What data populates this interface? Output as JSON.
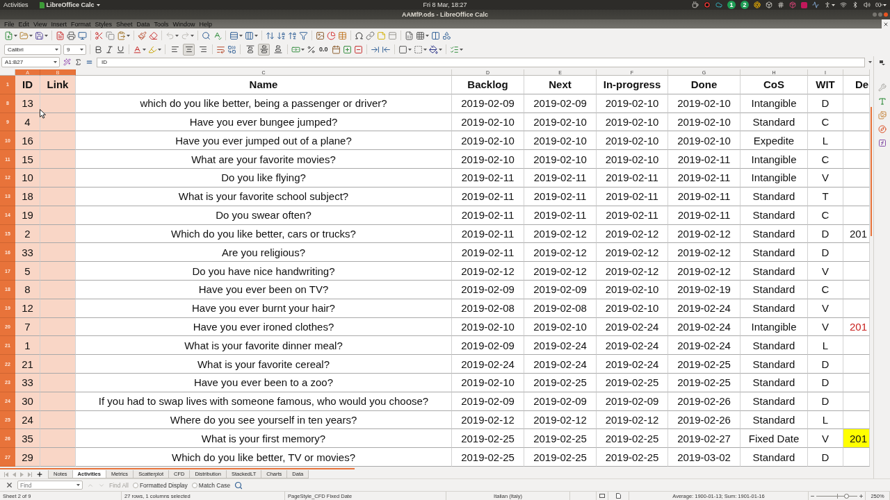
{
  "top_bar": {
    "activities": "Activities",
    "app_menu": "LibreOffice Calc",
    "clock": "Fri 8 Mar, 18:27",
    "tray_badges": [
      "1",
      "2"
    ]
  },
  "window": {
    "title": "AAMfP.ods - LibreOffice Calc"
  },
  "menu": [
    "File",
    "Edit",
    "View",
    "Insert",
    "Format",
    "Styles",
    "Sheet",
    "Data",
    "Tools",
    "Window",
    "Help"
  ],
  "toolbar": {
    "font_name": "Calibri",
    "font_size": "9",
    "number_format": "0.0",
    "horizontal_align": [
      {
        "kind": "left",
        "selected": false
      },
      {
        "kind": "center",
        "selected": true
      },
      {
        "kind": "right",
        "selected": false
      }
    ],
    "vertical_align": [
      {
        "kind": "top",
        "selected": false
      },
      {
        "kind": "middle",
        "selected": true
      },
      {
        "kind": "bottom",
        "selected": false
      }
    ]
  },
  "formula_bar": {
    "name_box": "A1:B27",
    "content": "ID"
  },
  "column_letters": [
    {
      "label": "A",
      "selected": true
    },
    {
      "label": "B",
      "selected": true
    },
    {
      "label": "C",
      "selected": false
    },
    {
      "label": "D",
      "selected": false
    },
    {
      "label": "E",
      "selected": false
    },
    {
      "label": "F",
      "selected": false
    },
    {
      "label": "G",
      "selected": false
    },
    {
      "label": "H",
      "selected": false
    },
    {
      "label": "I",
      "selected": false
    }
  ],
  "table": {
    "header_row": {
      "number": "1",
      "selected": true
    },
    "columns": [
      "ID",
      "Link",
      "Name",
      "Backlog",
      "Next",
      "In-progress",
      "Done",
      "CoS",
      "WIT",
      "De"
    ],
    "rows": [
      {
        "number": "8",
        "selected": true,
        "id": "13",
        "name": "which do you like better, being a passenger or driver?",
        "backlog": "2019-02-09",
        "next": "2019-02-09",
        "in_progress": "2019-02-10",
        "done": "2019-02-10",
        "cos": "Intangible",
        "wit": "D"
      },
      {
        "number": "9",
        "selected": true,
        "id": "4",
        "name": "Have you ever bungee jumped?",
        "backlog": "2019-02-10",
        "next": "2019-02-10",
        "in_progress": "2019-02-10",
        "done": "2019-02-10",
        "cos": "Standard",
        "wit": "C"
      },
      {
        "number": "10",
        "selected": true,
        "id": "16",
        "name": "Have you ever jumped out of a plane?",
        "backlog": "2019-02-10",
        "next": "2019-02-10",
        "in_progress": "2019-02-10",
        "done": "2019-02-10",
        "cos": "Expedite",
        "wit": "L"
      },
      {
        "number": "11",
        "selected": true,
        "id": "15",
        "name": "What are your favorite movies?",
        "backlog": "2019-02-10",
        "next": "2019-02-10",
        "in_progress": "2019-02-10",
        "done": "2019-02-11",
        "cos": "Intangible",
        "wit": "C"
      },
      {
        "number": "12",
        "selected": true,
        "id": "10",
        "name": "Do you like flying?",
        "backlog": "2019-02-11",
        "next": "2019-02-11",
        "in_progress": "2019-02-11",
        "done": "2019-02-11",
        "cos": "Intangible",
        "wit": "V"
      },
      {
        "number": "13",
        "selected": true,
        "id": "18",
        "name": "What is your favorite school subject?",
        "backlog": "2019-02-11",
        "next": "2019-02-11",
        "in_progress": "2019-02-11",
        "done": "2019-02-11",
        "cos": "Standard",
        "wit": "T"
      },
      {
        "number": "14",
        "selected": true,
        "id": "19",
        "name": "Do you swear often?",
        "backlog": "2019-02-11",
        "next": "2019-02-11",
        "in_progress": "2019-02-11",
        "done": "2019-02-11",
        "cos": "Standard",
        "wit": "C"
      },
      {
        "number": "15",
        "selected": true,
        "id": "2",
        "name": "Which do you like better, cars or trucks?",
        "backlog": "2019-02-11",
        "next": "2019-02-12",
        "in_progress": "2019-02-12",
        "done": "2019-02-12",
        "cos": "Standard",
        "wit": "D",
        "de": {
          "text": "201",
          "highlighted": false
        }
      },
      {
        "number": "16",
        "selected": true,
        "id": "33",
        "name": "Are you religious?",
        "backlog": "2019-02-11",
        "next": "2019-02-12",
        "in_progress": "2019-02-12",
        "done": "2019-02-12",
        "cos": "Standard",
        "wit": "D"
      },
      {
        "number": "17",
        "selected": true,
        "id": "5",
        "name": "Do you have nice handwriting?",
        "backlog": "2019-02-12",
        "next": "2019-02-12",
        "in_progress": "2019-02-12",
        "done": "2019-02-12",
        "cos": "Standard",
        "wit": "V"
      },
      {
        "number": "18",
        "selected": true,
        "id": "8",
        "name": "Have you ever been on TV?",
        "backlog": "2019-02-09",
        "next": "2019-02-09",
        "in_progress": "2019-02-10",
        "done": "2019-02-19",
        "cos": "Standard",
        "wit": "C"
      },
      {
        "number": "19",
        "selected": true,
        "id": "12",
        "name": "Have you ever burnt your hair?",
        "backlog": "2019-02-08",
        "next": "2019-02-08",
        "in_progress": "2019-02-10",
        "done": "2019-02-24",
        "cos": "Standard",
        "wit": "V"
      },
      {
        "number": "20",
        "selected": true,
        "id": "7",
        "name": "Have you ever ironed clothes?",
        "backlog": "2019-02-10",
        "next": "2019-02-10",
        "in_progress": "2019-02-24",
        "done": "2019-02-24",
        "cos": "Intangible",
        "wit": "V",
        "de": {
          "text": "201",
          "color": "#c9211e",
          "highlighted": false
        }
      },
      {
        "number": "21",
        "selected": true,
        "id": "1",
        "name": "What is your favorite dinner meal?",
        "backlog": "2019-02-09",
        "next": "2019-02-24",
        "in_progress": "2019-02-24",
        "done": "2019-02-24",
        "cos": "Standard",
        "wit": "L"
      },
      {
        "number": "22",
        "selected": true,
        "id": "21",
        "name": "What is your favorite cereal?",
        "backlog": "2019-02-24",
        "next": "2019-02-24",
        "in_progress": "2019-02-24",
        "done": "2019-02-25",
        "cos": "Standard",
        "wit": "D"
      },
      {
        "number": "23",
        "selected": true,
        "id": "33",
        "name": "Have you ever been to a zoo?",
        "backlog": "2019-02-10",
        "next": "2019-02-25",
        "in_progress": "2019-02-25",
        "done": "2019-02-25",
        "cos": "Standard",
        "wit": "D"
      },
      {
        "number": "24",
        "selected": true,
        "id": "30",
        "name": "If you had to swap lives with someone famous, who would you choose?",
        "backlog": "2019-02-09",
        "next": "2019-02-09",
        "in_progress": "2019-02-09",
        "done": "2019-02-26",
        "cos": "Standard",
        "wit": "D"
      },
      {
        "number": "25",
        "selected": true,
        "id": "24",
        "name": "Where do you see yourself in ten years?",
        "backlog": "2019-02-12",
        "next": "2019-02-12",
        "in_progress": "2019-02-12",
        "done": "2019-02-26",
        "cos": "Standard",
        "wit": "L"
      },
      {
        "number": "26",
        "selected": true,
        "id": "35",
        "name": "What is your first memory?",
        "backlog": "2019-02-25",
        "next": "2019-02-25",
        "in_progress": "2019-02-25",
        "done": "2019-02-27",
        "cos": "Fixed Date",
        "wit": "V",
        "de": {
          "text": "201",
          "highlighted": true
        }
      },
      {
        "number": "27",
        "selected": true,
        "id": "29",
        "name": "Which do you like better, TV or movies?",
        "backlog": "2019-02-25",
        "next": "2019-02-25",
        "in_progress": "2019-02-25",
        "done": "2019-03-02",
        "cos": "Standard",
        "wit": "D"
      }
    ]
  },
  "sheet_tabs": [
    {
      "label": "Notes",
      "selected": false
    },
    {
      "label": "Activities",
      "selected": true
    },
    {
      "label": "Metrics",
      "selected": false
    },
    {
      "label": "Scatterplot",
      "selected": false
    },
    {
      "label": "CFD",
      "selected": false
    },
    {
      "label": "Distribution",
      "selected": false
    },
    {
      "label": "StackedLT",
      "selected": false
    },
    {
      "label": "Charts",
      "selected": false
    },
    {
      "label": "Data",
      "selected": false
    }
  ],
  "find_bar": {
    "placeholder": "Find",
    "find_all": {
      "label": "Find All",
      "disabled": true
    },
    "options": [
      {
        "label": "Formatted Display",
        "checked": false
      },
      {
        "label": "Match Case",
        "checked": false
      }
    ]
  },
  "status_bar": {
    "sheet": "Sheet 2 of 9",
    "selection": "27 rows, 1 columns selected",
    "page_style": "PageStyle_CFD Fixed Date",
    "language": "Italian (Italy)",
    "summary": "Average: 1900-01-13; Sum: 1901-01-16",
    "zoom": "250%",
    "zoom_slider": {
      "level": 0.74
    }
  }
}
